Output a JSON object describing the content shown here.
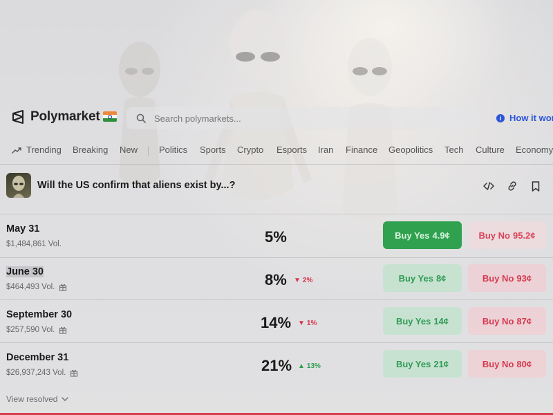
{
  "brand": {
    "name": "Polymarket"
  },
  "search": {
    "placeholder": "Search polymarkets..."
  },
  "header": {
    "how_it_works": "How it work"
  },
  "nav": {
    "items": [
      {
        "label": "Trending"
      },
      {
        "label": "Breaking"
      },
      {
        "label": "New"
      },
      {
        "label": "Politics"
      },
      {
        "label": "Sports"
      },
      {
        "label": "Crypto"
      },
      {
        "label": "Esports"
      },
      {
        "label": "Iran"
      },
      {
        "label": "Finance"
      },
      {
        "label": "Geopolitics"
      },
      {
        "label": "Tech"
      },
      {
        "label": "Culture"
      },
      {
        "label": "Economy"
      }
    ]
  },
  "market": {
    "title": "Will the US confirm that aliens exist by...?",
    "rows": [
      {
        "date": "May 31",
        "volume": "$1,484,861 Vol.",
        "percent": "5%",
        "change": "",
        "change_dir": "",
        "yes_label": "Buy Yes",
        "yes_price": "4.9¢",
        "no_label": "Buy No",
        "no_price": "95.2¢"
      },
      {
        "date": "June 30",
        "volume": "$464,493 Vol.",
        "percent": "8%",
        "change": "2%",
        "change_dir": "down",
        "yes_label": "Buy Yes",
        "yes_price": "8¢",
        "no_label": "Buy No",
        "no_price": "93¢"
      },
      {
        "date": "September 30",
        "volume": "$257,590 Vol.",
        "percent": "14%",
        "change": "1%",
        "change_dir": "down",
        "yes_label": "Buy Yes",
        "yes_price": "14¢",
        "no_label": "Buy No",
        "no_price": "87¢"
      },
      {
        "date": "December 31",
        "volume": "$26,937,243 Vol.",
        "percent": "21%",
        "change": "13%",
        "change_dir": "up",
        "yes_label": "Buy Yes",
        "yes_price": "21¢",
        "no_label": "Buy No",
        "no_price": "80¢"
      }
    ],
    "view_resolved": "View resolved"
  },
  "colors": {
    "accent_blue": "#2b55d9",
    "yes_green": "#2fa14f",
    "no_red": "#d63a4f"
  }
}
